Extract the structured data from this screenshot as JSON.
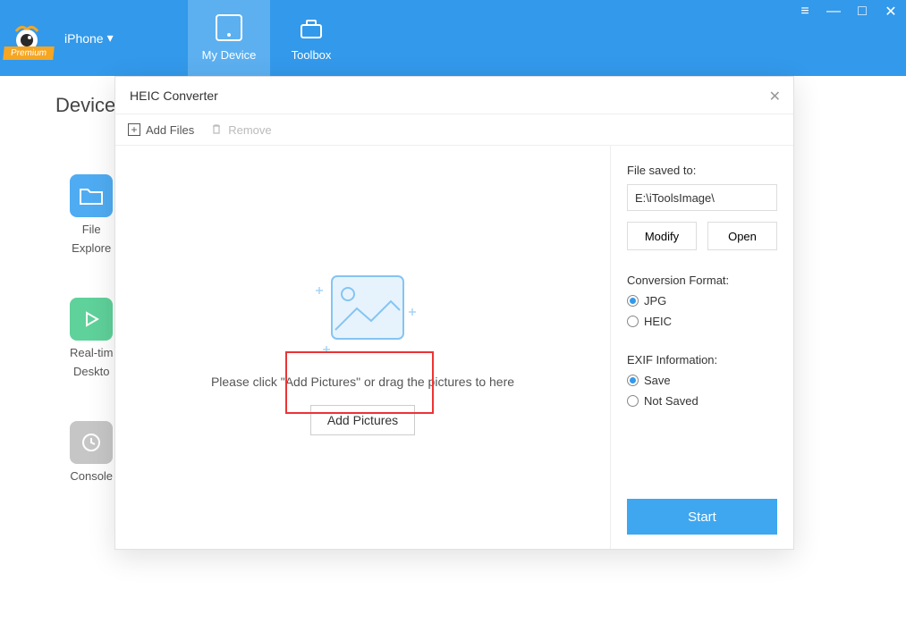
{
  "header": {
    "premium_label": "Premium",
    "device_dropdown": "iPhone",
    "tabs": {
      "my_device": "My Device",
      "toolbox": "Toolbox"
    }
  },
  "background": {
    "section_title": "Device",
    "items": {
      "file_explorer_l1": "File",
      "file_explorer_l2": "Explore",
      "realtime_l1": "Real-tim",
      "realtime_l2": "Deskto",
      "console": "Console"
    }
  },
  "dialog": {
    "title": "HEIC Converter",
    "toolbar": {
      "add_files": "Add Files",
      "remove": "Remove"
    },
    "drop_area": {
      "hint": "Please click \"Add Pictures\" or drag the pictures to here",
      "add_button": "Add Pictures"
    },
    "side": {
      "saved_to_label": "File saved to:",
      "saved_to_value": "E:\\iToolsImage\\",
      "modify": "Modify",
      "open": "Open",
      "format_label": "Conversion Format:",
      "format_jpg": "JPG",
      "format_heic": "HEIC",
      "exif_label": "EXIF Information:",
      "exif_save": "Save",
      "exif_not_saved": "Not Saved",
      "start": "Start"
    }
  }
}
